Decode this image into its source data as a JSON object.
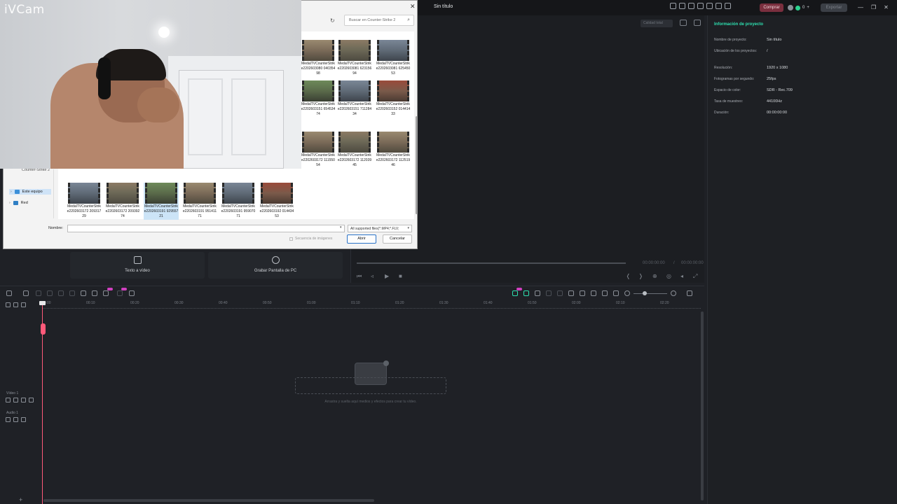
{
  "window": {
    "title": "Sin título"
  },
  "header": {
    "buy_label": "Comprar",
    "user_count": "0",
    "export_label": "Exportar",
    "controls": [
      "—",
      "❐",
      "✕"
    ]
  },
  "player": {
    "quality_label": "Calidad total",
    "time_current": "00:00:00:00",
    "time_separator": "/",
    "time_total": "00:00:00:00"
  },
  "info_panel": {
    "title": "Información de proyecto",
    "rows": [
      {
        "label": "Nombre de proyecto:",
        "value": "Sin título"
      },
      {
        "label": "Ubicación de los proyectos:",
        "value": "/"
      },
      {
        "label": "Resolución:",
        "value": "1920 x 1080"
      },
      {
        "label": "Fotogramas por segundo:",
        "value": "25fps"
      },
      {
        "label": "Espacio de color:",
        "value": "SDR - Rec.709"
      },
      {
        "label": "Tasa de muestreo:",
        "value": "44100Hz"
      },
      {
        "label": "Duración:",
        "value": "00:00:00:00"
      }
    ]
  },
  "media_buttons": [
    {
      "label": "Texto a vídeo",
      "icon": "edit-icon"
    },
    {
      "label": "Grabar Pantalla de PC",
      "icon": "record-icon"
    }
  ],
  "timeline": {
    "ticks": [
      "00:00",
      "00:10",
      "00:20",
      "00:30",
      "00:40",
      "00:50",
      "01:00",
      "01:10",
      "01:20",
      "01:30",
      "01:40",
      "01:50",
      "02:00",
      "02:10",
      "02:20"
    ],
    "tracks": [
      {
        "label": "Vídeo 1"
      },
      {
        "label": "Audio 1"
      }
    ],
    "drop_hint": "Arrastra y suelta aquí medios y efectos para crear tu vídeo.",
    "add_track": "+"
  },
  "webcam": {
    "brand": "iVCam"
  },
  "file_dialog": {
    "search_placeholder": "Buscar en Counter-Strike 2",
    "nav": {
      "partial_folder": "Counter-Strike 2",
      "items": [
        {
          "label": "Este equipo",
          "selected": true
        },
        {
          "label": "Red",
          "selected": false
        }
      ]
    },
    "files": [
      {
        "name": "MedalTVCounterStrike2202603080 04035498"
      },
      {
        "name": "MedalTVCounterStrike2202603081 62315694"
      },
      {
        "name": "MedalTVCounterStrike2202603081 62545053"
      },
      {
        "name": "MedalTVCounterStrike2202603151 65453474"
      },
      {
        "name": "MedalTVCounterStrike2202603151 71128434"
      },
      {
        "name": "MedalTVCounterStrike2202603152 01441433"
      },
      {
        "name": "MedalTVCounterStrike2202603172 11155054"
      },
      {
        "name": "MedalTVCounterStrike2202603172 11203945"
      },
      {
        "name": "MedalTVCounterStrike2202603172 11251946"
      },
      {
        "name": "MedalTVCounterStrike2202603172 20931729"
      },
      {
        "name": "MedalTVCounterStrike2202603172 20939274"
      },
      {
        "name": "MedalTVCounterStrike2202603191 92955721"
      },
      {
        "name": "MedalTVCounterStrike2202603191 95141171"
      },
      {
        "name": "MedalTVCounterStrike2202603191 95907071"
      },
      {
        "name": "MedalTVCounterStrike2202603192 01443453"
      }
    ],
    "name_label": "Nombre:",
    "name_value": "",
    "filter_label": "All supported files(*.MP4;*.FLV;",
    "sequence_label": "Secuencia de imágenes",
    "open_label": "Abrir",
    "cancel_label": "Cancelar",
    "close_glyph": "✕"
  },
  "colors": {
    "accent": "#2ee0b0",
    "buy": "#7a2f3e",
    "playhead": "#ff5a7a",
    "selection": "#cce4f7"
  }
}
